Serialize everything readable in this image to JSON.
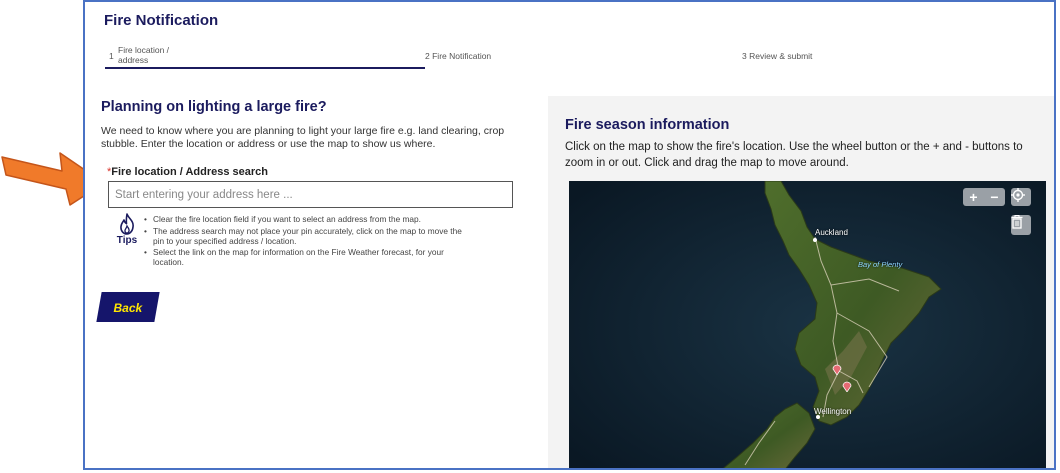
{
  "app": {
    "title": "Fire Notification"
  },
  "steps": [
    {
      "number": "1",
      "label": "Fire location / address"
    },
    {
      "number": "2",
      "label": "Fire Notification"
    },
    {
      "number": "3",
      "label": "Review & submit"
    }
  ],
  "left": {
    "heading": "Planning on lighting a large fire?",
    "intro": "We need to know where you are planning to light your large fire e.g. land clearing, crop stubble. Enter the location or address or use the map to show us where.",
    "field_required_mark": "*",
    "field_label": "Fire location / Address search",
    "address_placeholder": "Start entering your address here ...",
    "tips_label": "Tips",
    "tips": [
      "Clear the fire location field if you want to select an address from the map.",
      "The address search may not place your pin accurately, click on the map to move the pin to your specified address / location.",
      "Select the link on the map for information on the Fire Weather forecast, for your location."
    ],
    "back_label": "Back"
  },
  "right": {
    "heading": "Fire season information",
    "intro": "Click on the map to show the fire's location. Use the wheel button or the + and - buttons to zoom in or out. Click and drag the map to move around.",
    "map": {
      "labels": {
        "auckland": "Auckland",
        "bay": "Bay of Plenty",
        "wellington": "Wellington"
      },
      "pins": [
        "1",
        "2"
      ],
      "zoom_in": "+",
      "zoom_out": "−"
    }
  },
  "annotation": {
    "arrow_color": "#f07a2a"
  }
}
